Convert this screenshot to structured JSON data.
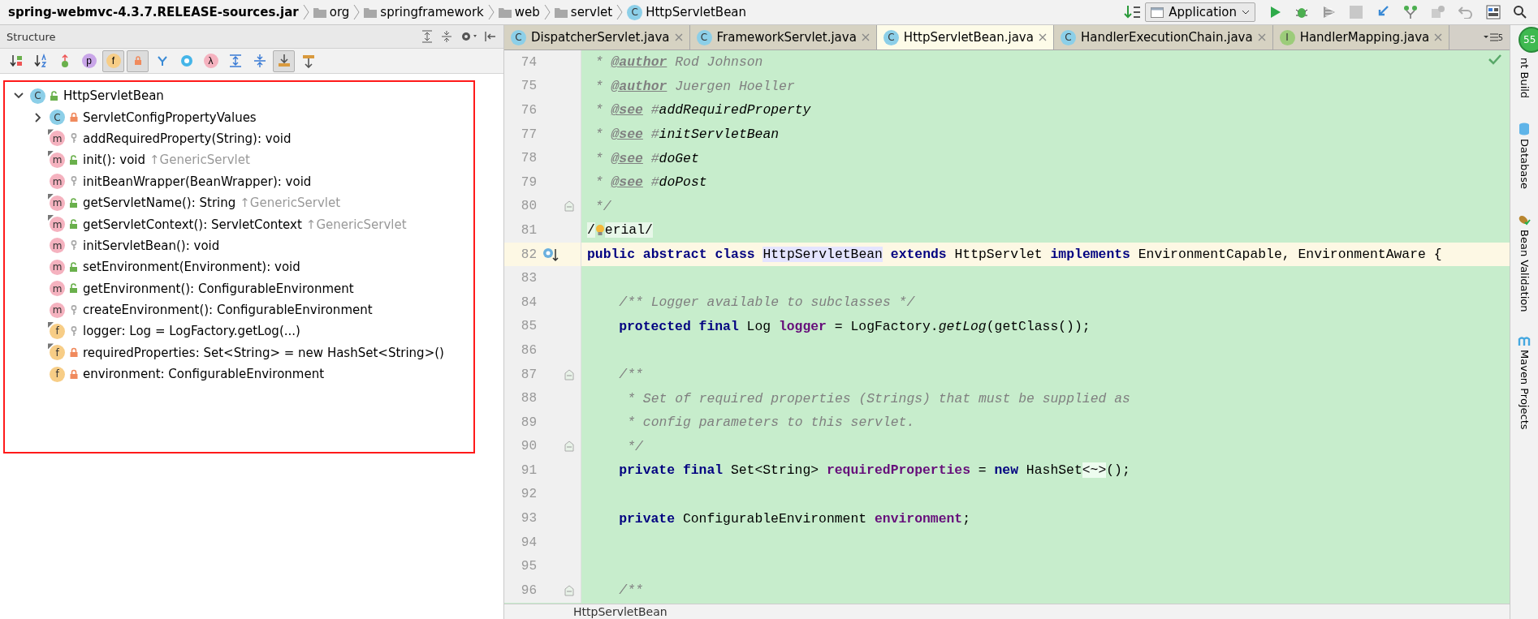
{
  "breadcrumbs": [
    {
      "label": "spring-webmvc-4.3.7.RELEASE-sources.jar",
      "kind": "jar"
    },
    {
      "label": "org",
      "kind": "folder"
    },
    {
      "label": "springframework",
      "kind": "folder"
    },
    {
      "label": "web",
      "kind": "folder"
    },
    {
      "label": "servlet",
      "kind": "folder"
    },
    {
      "label": "HttpServletBean",
      "kind": "class",
      "glyph": "C"
    }
  ],
  "run_config": "Application",
  "structure": {
    "title": "Structure",
    "toolbar": [
      {
        "kind": "sort-visibility",
        "selected": false
      },
      {
        "kind": "sort-alpha",
        "selected": false
      },
      {
        "kind": "inherited",
        "selected": false
      },
      {
        "kind": "properties",
        "glyph": "p",
        "selected": false
      },
      {
        "kind": "fields",
        "glyph": "f",
        "selected": true
      },
      {
        "kind": "non-public",
        "selected": true
      },
      {
        "kind": "hierarchy",
        "selected": false
      },
      {
        "kind": "anonymous",
        "selected": false
      },
      {
        "kind": "lambdas",
        "glyph": "λ",
        "selected": false
      },
      {
        "kind": "expand",
        "selected": false
      },
      {
        "kind": "collapse",
        "selected": false
      },
      {
        "kind": "autoscroll-to",
        "selected": true
      },
      {
        "kind": "autoscroll-from",
        "selected": false
      }
    ],
    "tree": [
      {
        "label": "HttpServletBean",
        "kind": "class",
        "glyph": "C",
        "access": {
          "kind": "public"
        },
        "overrides": false,
        "expanded": true,
        "children": [
          {
            "label": "ServletConfigPropertyValues",
            "kind": "class",
            "glyph": "C",
            "access": {
              "kind": "private"
            },
            "overrides": false,
            "expanded": false
          },
          {
            "label": "addRequiredProperty(String): void",
            "kind": "method",
            "glyph": "m",
            "access": {
              "kind": "package"
            },
            "overrides": true
          },
          {
            "label": "init(): void",
            "inherited": "↑GenericServlet",
            "kind": "method",
            "glyph": "m",
            "access": {
              "kind": "public"
            },
            "overrides": true
          },
          {
            "label": "initBeanWrapper(BeanWrapper): void",
            "kind": "method",
            "glyph": "m",
            "access": {
              "kind": "package"
            },
            "overrides": false
          },
          {
            "label": "getServletName(): String",
            "inherited": "↑GenericServlet",
            "kind": "method",
            "glyph": "m",
            "access": {
              "kind": "public"
            },
            "overrides": true
          },
          {
            "label": "getServletContext(): ServletContext",
            "inherited": "↑GenericServlet",
            "kind": "method",
            "glyph": "m",
            "access": {
              "kind": "public"
            },
            "overrides": true
          },
          {
            "label": "initServletBean(): void",
            "kind": "method",
            "glyph": "m",
            "access": {
              "kind": "package"
            },
            "overrides": false
          },
          {
            "label": "setEnvironment(Environment): void",
            "kind": "method",
            "glyph": "m",
            "access": {
              "kind": "public"
            },
            "overrides": false
          },
          {
            "label": "getEnvironment(): ConfigurableEnvironment",
            "kind": "method",
            "glyph": "m",
            "access": {
              "kind": "public"
            },
            "overrides": false
          },
          {
            "label": "createEnvironment(): ConfigurableEnvironment",
            "kind": "method",
            "glyph": "m",
            "access": {
              "kind": "package"
            },
            "overrides": false
          },
          {
            "label": "logger: Log = LogFactory.getLog(...)",
            "kind": "field",
            "glyph": "f",
            "access": {
              "kind": "package"
            },
            "overrides": true
          },
          {
            "label": "requiredProperties: Set<String> = new HashSet<String>()",
            "kind": "field",
            "glyph": "f",
            "access": {
              "kind": "private"
            },
            "overrides": true
          },
          {
            "label": "environment: ConfigurableEnvironment",
            "kind": "field",
            "glyph": "f",
            "access": {
              "kind": "private"
            },
            "overrides": false
          }
        ]
      }
    ]
  },
  "tabs": [
    {
      "label": "DispatcherServlet.java",
      "kind": "class",
      "glyph": "C",
      "selected": false
    },
    {
      "label": "FrameworkServlet.java",
      "kind": "class",
      "glyph": "C",
      "selected": false
    },
    {
      "label": "HttpServletBean.java",
      "kind": "class",
      "glyph": "C",
      "selected": true
    },
    {
      "label": "HandlerExecutionChain.java",
      "kind": "class",
      "glyph": "C",
      "selected": false
    },
    {
      "label": "HandlerMapping.java",
      "kind": "interface",
      "glyph": "I",
      "selected": false
    }
  ],
  "tab_overflow": "5",
  "code": [
    {
      "number": "74",
      "tokens": [
        {
          "kind": "doc",
          "text": " * "
        },
        {
          "kind": "doctag",
          "text": "@author"
        },
        {
          "kind": "doc",
          "text": " Rod Johnson"
        }
      ]
    },
    {
      "number": "75",
      "tokens": [
        {
          "kind": "doc",
          "text": " * "
        },
        {
          "kind": "doctag",
          "text": "@author"
        },
        {
          "kind": "doc",
          "text": " Juergen Hoeller"
        }
      ]
    },
    {
      "number": "76",
      "tokens": [
        {
          "kind": "doc",
          "text": " * "
        },
        {
          "kind": "doctag",
          "text": "@see"
        },
        {
          "kind": "doc",
          "text": " #"
        },
        {
          "kind": "docref",
          "text": "addRequiredProperty"
        }
      ]
    },
    {
      "number": "77",
      "tokens": [
        {
          "kind": "doc",
          "text": " * "
        },
        {
          "kind": "doctag",
          "text": "@see"
        },
        {
          "kind": "doc",
          "text": " #"
        },
        {
          "kind": "docref",
          "text": "initServletBean"
        }
      ]
    },
    {
      "number": "78",
      "tokens": [
        {
          "kind": "doc",
          "text": " * "
        },
        {
          "kind": "doctag",
          "text": "@see"
        },
        {
          "kind": "doc",
          "text": " #"
        },
        {
          "kind": "docref",
          "text": "doGet"
        }
      ]
    },
    {
      "number": "79",
      "tokens": [
        {
          "kind": "doc",
          "text": " * "
        },
        {
          "kind": "doctag",
          "text": "@see"
        },
        {
          "kind": "doc",
          "text": " #"
        },
        {
          "kind": "docref",
          "text": "doPost"
        }
      ]
    },
    {
      "number": "80",
      "fold": true,
      "tokens": [
        {
          "kind": "doc",
          "text": " */"
        }
      ]
    },
    {
      "number": "81",
      "tokens": [
        {
          "kind": "annotation",
          "text": "/"
        },
        {
          "kind": "bulb"
        },
        {
          "kind": "annotation",
          "text": "erial/"
        }
      ]
    },
    {
      "number": "82",
      "current": true,
      "marker": {
        "kind": "implemented"
      },
      "tokens": [
        {
          "kind": "kw",
          "text": "public abstract class "
        },
        {
          "kind": "hl",
          "text": "HttpServletBean"
        },
        {
          "kind": "kw",
          "text": " extends"
        },
        {
          "kind": "plain",
          "text": " HttpServlet "
        },
        {
          "kind": "kw",
          "text": "implements"
        },
        {
          "kind": "plain",
          "text": " EnvironmentCapable, EnvironmentAware {"
        }
      ]
    },
    {
      "number": "83"
    },
    {
      "number": "84",
      "tokens": [
        {
          "kind": "doc",
          "text": "    /** Logger available to subclasses */"
        }
      ]
    },
    {
      "number": "85",
      "indented": true,
      "tokens": [
        {
          "kind": "kw",
          "text": "protected final"
        },
        {
          "kind": "plain",
          "text": " Log "
        },
        {
          "kind": "field",
          "text": "logger"
        },
        {
          "kind": "plain",
          "text": " = LogFactory."
        },
        {
          "kind": "static",
          "text": "getLog"
        },
        {
          "kind": "plain",
          "text": "(getClass());"
        }
      ]
    },
    {
      "number": "86"
    },
    {
      "number": "87",
      "fold": true,
      "tokens": [
        {
          "kind": "doc",
          "text": "    /**"
        }
      ]
    },
    {
      "number": "88",
      "tokens": [
        {
          "kind": "doc",
          "text": "     * Set of required properties (Strings) that must be supplied as"
        }
      ]
    },
    {
      "number": "89",
      "tokens": [
        {
          "kind": "doc",
          "text": "     * config parameters to this servlet."
        }
      ]
    },
    {
      "number": "90",
      "fold": true,
      "tokens": [
        {
          "kind": "doc",
          "text": "     */"
        }
      ]
    },
    {
      "number": "91",
      "indented": true,
      "tokens": [
        {
          "kind": "kw",
          "text": "private final"
        },
        {
          "kind": "plain",
          "text": " Set<String> "
        },
        {
          "kind": "field",
          "text": "requiredProperties"
        },
        {
          "kind": "plain",
          "text": " = "
        },
        {
          "kind": "kw",
          "text": "new"
        },
        {
          "kind": "plain",
          "text": " HashSet"
        },
        {
          "kind": "diamond",
          "text": "<~>"
        },
        {
          "kind": "plain",
          "text": "();"
        }
      ]
    },
    {
      "number": "92"
    },
    {
      "number": "93",
      "indented": true,
      "tokens": [
        {
          "kind": "kw",
          "text": "private"
        },
        {
          "kind": "plain",
          "text": " ConfigurableEnvironment "
        },
        {
          "kind": "field",
          "text": "environment"
        },
        {
          "kind": "plain",
          "text": ";"
        }
      ]
    },
    {
      "number": "94"
    },
    {
      "number": "95"
    },
    {
      "number": "96",
      "fold": true,
      "tokens": [
        {
          "kind": "doc",
          "text": "    /**"
        }
      ]
    }
  ],
  "editor_breadcrumb": "HttpServletBean",
  "side_tools": [
    {
      "label": "nt Build",
      "kind": "ant"
    },
    {
      "label": "Database",
      "kind": "database"
    },
    {
      "label": "Bean Validation",
      "kind": "bean"
    },
    {
      "label": "Maven Projects",
      "kind": "maven"
    }
  ],
  "notification_count": "55"
}
